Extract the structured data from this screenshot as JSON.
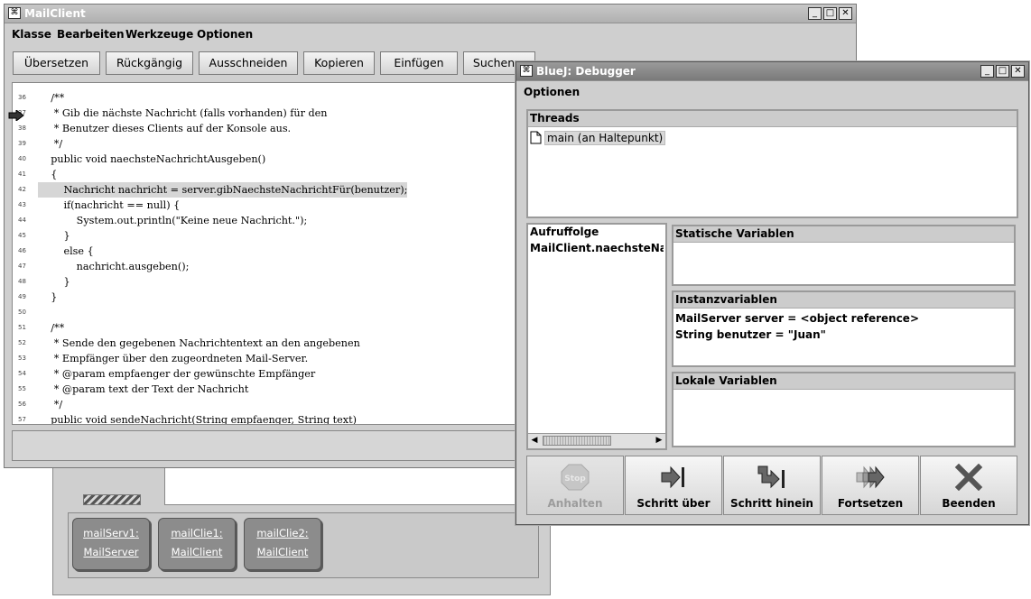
{
  "bluej_main": {
    "objects": [
      {
        "name": "mailServ1:",
        "class": "MailServer"
      },
      {
        "name": "mailClie1:",
        "class": "MailClient"
      },
      {
        "name": "mailClie2:",
        "class": "MailClient"
      }
    ]
  },
  "mailclient": {
    "title": "MailClient",
    "menu": [
      "Klasse",
      "Bearbeiten",
      "Werkzeuge",
      "Optionen"
    ],
    "toolbar": [
      "Übersetzen",
      "Rückgängig",
      "Ausschneiden",
      "Kopieren",
      "Einfügen",
      "Suchen..."
    ],
    "code": [
      {
        "no": "36",
        "text": "    /**"
      },
      {
        "no": "37",
        "text": "     * Gib die nächste Nachricht (falls vorhanden) für den"
      },
      {
        "no": "38",
        "text": "     * Benutzer dieses Clients auf der Konsole aus."
      },
      {
        "no": "39",
        "text": "     */"
      },
      {
        "no": "40",
        "text": "    public void naechsteNachrichtAusgeben()"
      },
      {
        "no": "41",
        "text": "    {"
      },
      {
        "no": "42",
        "text": "        Nachricht nachricht = server.gibNaechsteNachrichtFür(benutzer);"
      },
      {
        "no": "43",
        "text": "        if(nachricht == null) {"
      },
      {
        "no": "44",
        "text": "            System.out.println(\"Keine neue Nachricht.\");"
      },
      {
        "no": "45",
        "text": "        }"
      },
      {
        "no": "46",
        "text": "        else {"
      },
      {
        "no": "47",
        "text": "            nachricht.ausgeben();"
      },
      {
        "no": "48",
        "text": "        }"
      },
      {
        "no": "49",
        "text": "    }"
      },
      {
        "no": "50",
        "text": ""
      },
      {
        "no": "51",
        "text": "    /**"
      },
      {
        "no": "52",
        "text": "     * Sende den gegebenen Nachrichtentext an den angebenen"
      },
      {
        "no": "53",
        "text": "     * Empfänger über den zugeordneten Mail-Server."
      },
      {
        "no": "54",
        "text": "     * @param empfaenger der gewünschte Empfänger"
      },
      {
        "no": "55",
        "text": "     * @param text der Text der Nachricht"
      },
      {
        "no": "56",
        "text": "     */"
      },
      {
        "no": "57",
        "text": "    public void sendeNachricht(String empfaenger, String text)"
      }
    ],
    "highlight_line": "42"
  },
  "debugger": {
    "title": "BlueJ: Debugger",
    "menu": "Optionen",
    "threads_header": "Threads",
    "thread_item": "main (an Haltepunkt)",
    "callstack_header": "Aufruffolge",
    "callstack_item": "MailClient.naechsteNachrich",
    "static_header": "Statische Variablen",
    "instance_header": "Instanzvariablen",
    "instance_vars": [
      "MailServer server = <object reference>",
      "String benutzer = \"Juan\""
    ],
    "local_header": "Lokale Variablen",
    "buttons": {
      "stop_icon_text": "Stop",
      "stop": "Anhalten",
      "step": "Schritt über",
      "step_into": "Schritt hinein",
      "continue": "Fortsetzen",
      "terminate": "Beenden"
    }
  }
}
